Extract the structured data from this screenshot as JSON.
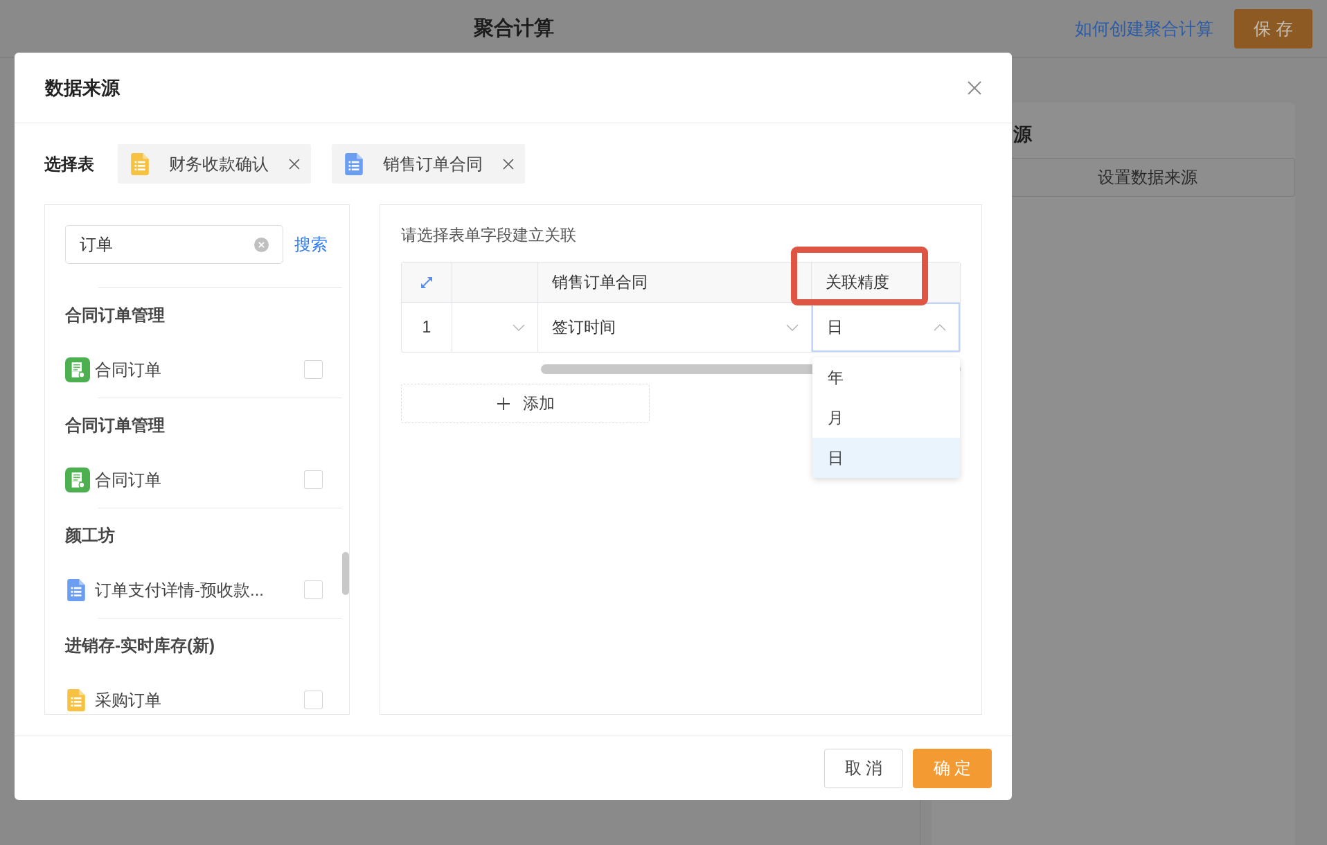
{
  "background": {
    "title": "聚合计算",
    "help_link": "如何创建聚合计算",
    "save_button": "保 存",
    "panel_title": "源",
    "panel_button": "设置数据来源"
  },
  "dialog": {
    "title": "数据来源",
    "select_label": "选择表",
    "selected_tables": [
      {
        "name": "财务收款确认",
        "color": "#f7c242"
      },
      {
        "name": "销售订单合同",
        "color": "#6b9ef0"
      }
    ],
    "search": {
      "value": "订单",
      "button": "搜索"
    },
    "groups": [
      {
        "title": "合同订单管理",
        "items": [
          {
            "name": "合同订单",
            "kind": "form",
            "color": "#4caf50",
            "checked": false
          }
        ]
      },
      {
        "title": "合同订单管理",
        "items": [
          {
            "name": "合同订单",
            "kind": "form",
            "color": "#4caf50",
            "checked": false
          }
        ]
      },
      {
        "title": "颜工坊",
        "items": [
          {
            "name": "订单支付详情-预收款...",
            "kind": "list",
            "color": "#6b9ef0",
            "checked": false
          }
        ]
      },
      {
        "title": "进销存-实时库存(新)",
        "items": [
          {
            "name": "采购订单",
            "kind": "list",
            "color": "#f7c242",
            "checked": false
          }
        ]
      }
    ],
    "relation": {
      "instruction": "请选择表单字段建立关联",
      "columns": [
        {
          "label": "销售订单合同",
          "highlighted": false
        },
        {
          "label": "关联精度",
          "highlighted": true
        }
      ],
      "rows": [
        {
          "index": "1",
          "field": "签订时间",
          "precision": "日",
          "expanded": true
        }
      ],
      "precision_options": [
        {
          "label": "年",
          "selected": false
        },
        {
          "label": "月",
          "selected": false
        },
        {
          "label": "日",
          "selected": true
        }
      ],
      "add_button": "添加"
    },
    "buttons": [
      {
        "label": "取 消",
        "kind": "secondary"
      },
      {
        "label": "确 定",
        "kind": "primary"
      }
    ]
  }
}
